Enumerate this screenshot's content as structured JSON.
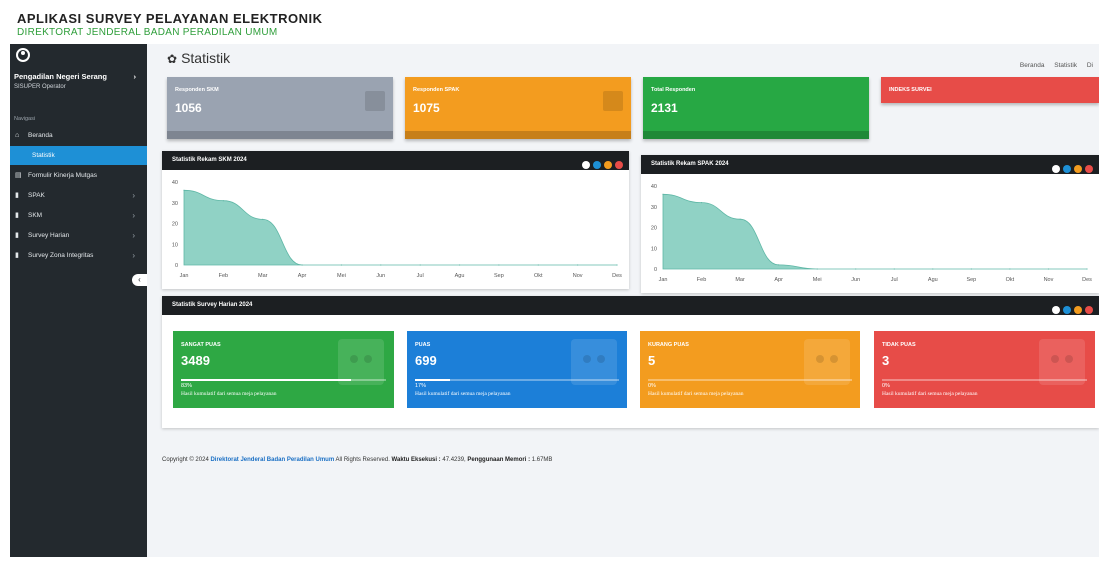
{
  "header": {
    "title": "APLIKASI SURVEY PELAYANAN ELEKTRONIK",
    "subtitle": "DIREKTORAT JENDERAL BADAN PERADILAN UMUM"
  },
  "sidebar": {
    "user_name": "Pengadilan Negeri Serang",
    "role": "SISUPER Operator",
    "section": "Navigasi",
    "items": [
      {
        "label": "Beranda",
        "icon": "home-icon"
      },
      {
        "label": "Statistik",
        "icon": ""
      },
      {
        "label": "Formulir Kinerja Mutgas",
        "icon": "file-icon"
      },
      {
        "label": "SPAK",
        "icon": "book-icon"
      },
      {
        "label": "SKM",
        "icon": "book-icon"
      },
      {
        "label": "Survey Harian",
        "icon": "book-icon"
      },
      {
        "label": "Survey Zona Integritas",
        "icon": "book-icon"
      }
    ]
  },
  "page": {
    "title": "Statistik",
    "breadcrumb": [
      "Beranda",
      "Statistik",
      "Di"
    ]
  },
  "stats": [
    {
      "label": "Responden SKM",
      "value": "1056",
      "color": "#9aa3b1"
    },
    {
      "label": "Responden SPAK",
      "value": "1075",
      "color": "#f39c1f"
    },
    {
      "label": "Total Responden",
      "value": "2131",
      "color": "#27a844"
    },
    {
      "label": "INDEKS SURVEI",
      "value": "",
      "color": "#e74c48"
    }
  ],
  "charts_meta": {
    "skm_title": "Statistik Rekam SKM 2024",
    "spak_title": "Statistik Rekam SPAK 2024",
    "harian_title": "Statistik Survey Harian 2024",
    "dot_colors": [
      "#ffffff",
      "#1e90d6",
      "#f39c1f",
      "#e74c48"
    ]
  },
  "chart_data": [
    {
      "type": "area",
      "title": "Statistik Rekam SKM 2024",
      "categories": [
        "Jan",
        "Feb",
        "Mar",
        "Apr",
        "Mei",
        "Jun",
        "Jul",
        "Agu",
        "Sep",
        "Okt",
        "Nov",
        "Des"
      ],
      "values": [
        36,
        31,
        22,
        0,
        0,
        0,
        0,
        0,
        0,
        0,
        0,
        0
      ],
      "yticks": [
        0,
        10,
        20,
        30,
        40
      ],
      "ylim": [
        0,
        40
      ],
      "color": "#7ccabb"
    },
    {
      "type": "area",
      "title": "Statistik Rekam SPAK 2024",
      "categories": [
        "Jan",
        "Feb",
        "Mar",
        "Apr",
        "Mei",
        "Jun",
        "Jul",
        "Agu",
        "Sep",
        "Okt",
        "Nov",
        "Des"
      ],
      "values": [
        36,
        32,
        24,
        2,
        0,
        0,
        0,
        0,
        0,
        0,
        0,
        0
      ],
      "yticks": [
        0,
        10,
        20,
        30,
        40
      ],
      "ylim": [
        0,
        40
      ],
      "color": "#7ccabb"
    }
  ],
  "satisfaction": [
    {
      "label": "SANGAT PUAS",
      "value": "3489",
      "percent": "83%",
      "progress": 0.83,
      "color": "#2ea844",
      "desc": "Hasil kumulatif dari semua meja pelayanan"
    },
    {
      "label": "PUAS",
      "value": "699",
      "percent": "17%",
      "progress": 0.17,
      "color": "#1c7fd8",
      "desc": "Hasil kumulatif dari semua meja pelayanan"
    },
    {
      "label": "KURANG PUAS",
      "value": "5",
      "percent": "0%",
      "progress": 0.0,
      "color": "#f39c1f",
      "desc": "Hasil kumulatif dari semua meja pelayanan"
    },
    {
      "label": "TIDAK PUAS",
      "value": "3",
      "percent": "0%",
      "progress": 0.0,
      "color": "#e74c48",
      "desc": "Hasil kumulatif dari semua meja pelayanan"
    }
  ],
  "footer": {
    "prefix": "Copyright © 2024",
    "link": "Direktorat Jenderal Badan Peradilan Umum",
    "rights": "All Rights Reserved.",
    "exec_label": "Waktu Eksekusi :",
    "exec_value": "47.4239,",
    "mem_label": "Penggunaan Memori :",
    "mem_value": "1.67MB"
  }
}
